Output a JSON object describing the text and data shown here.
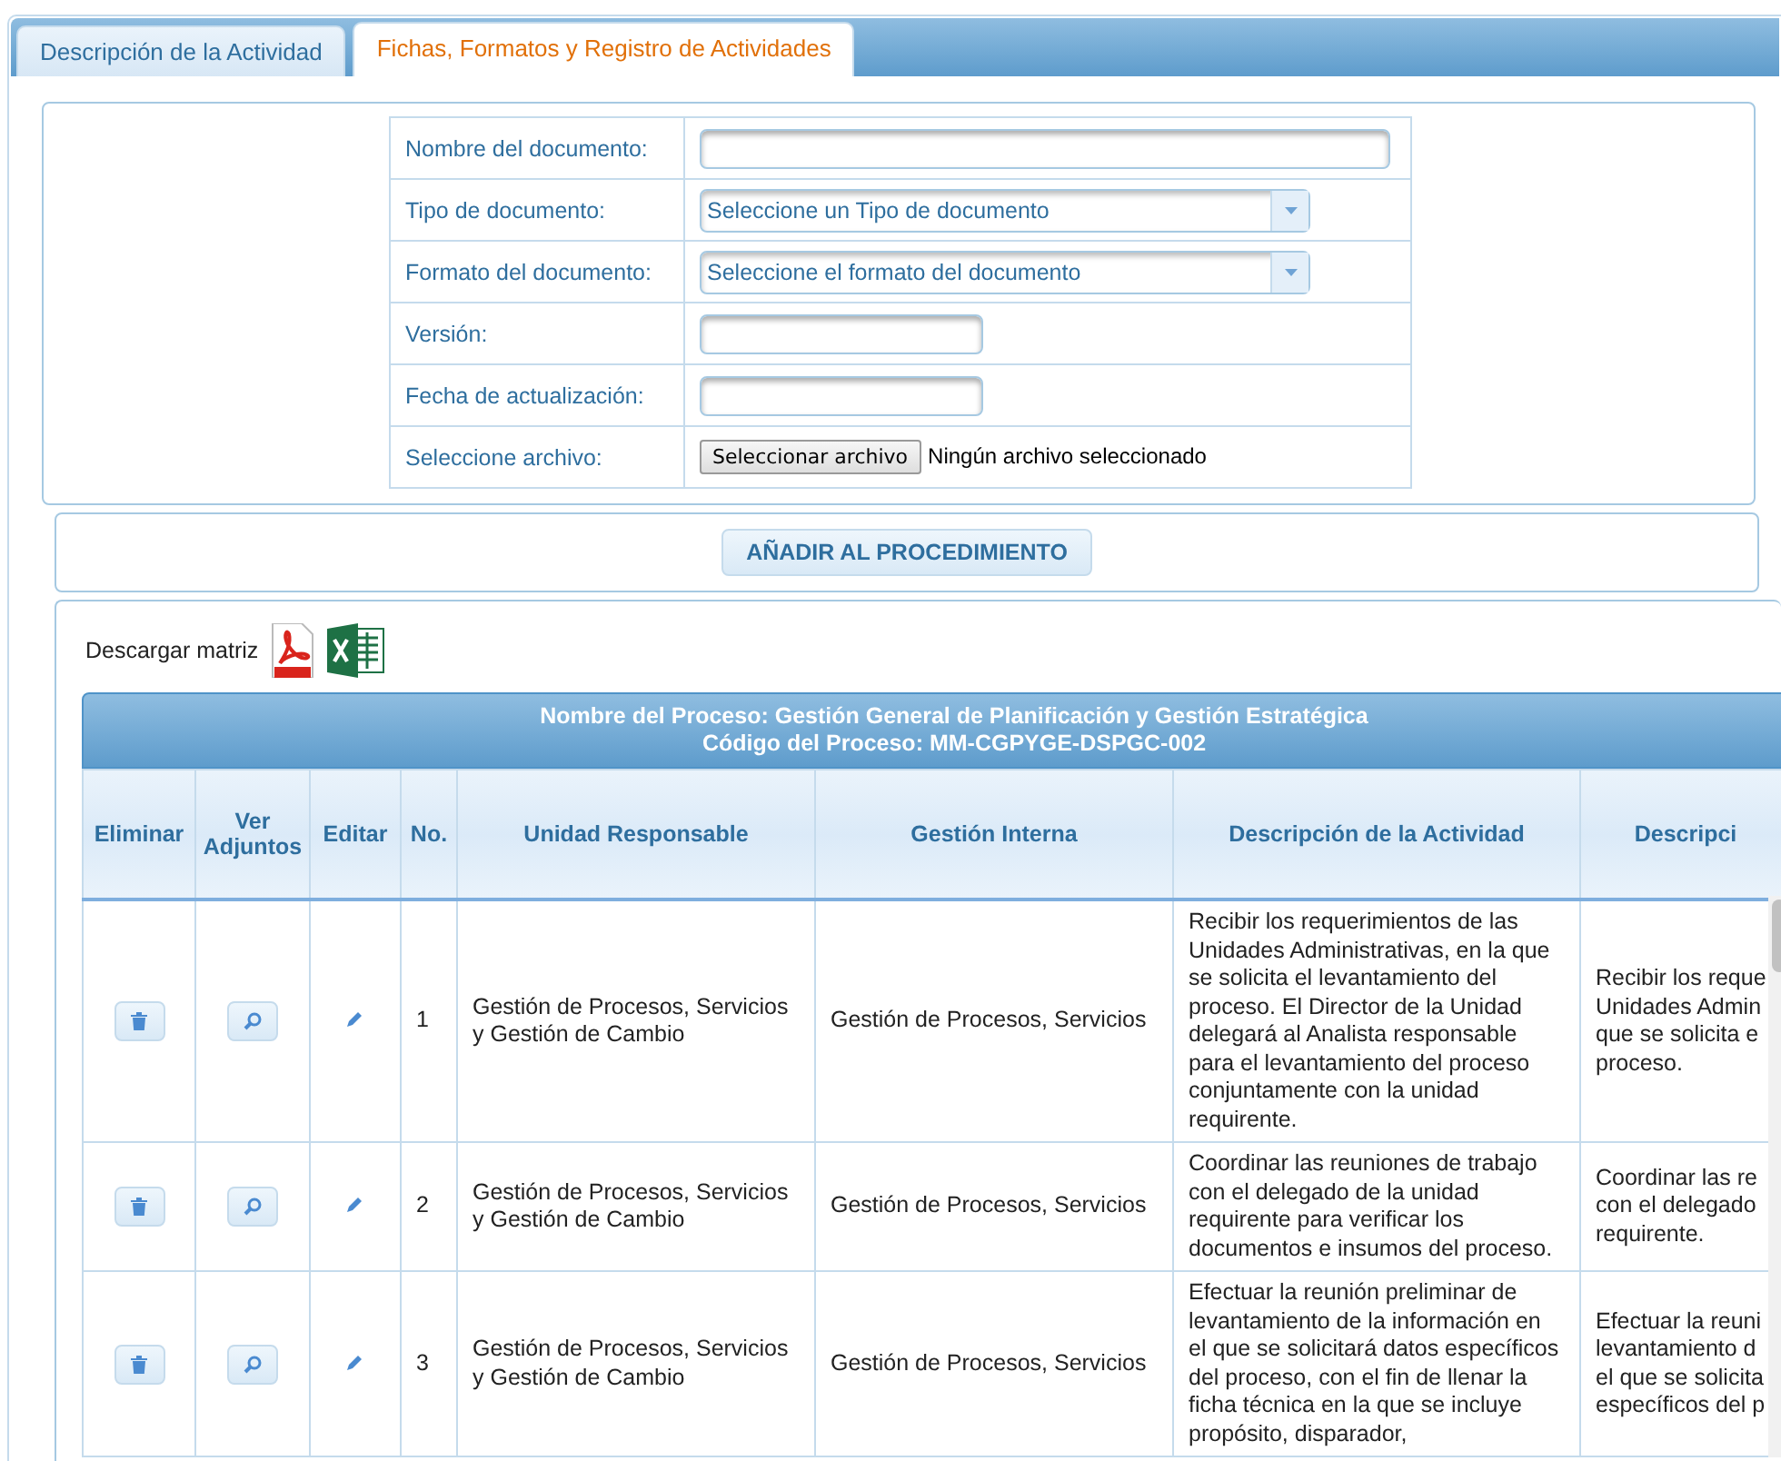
{
  "tabs": [
    {
      "label": "Descripción de la Actividad",
      "selected": false
    },
    {
      "label": "Fichas, Formatos y Registro de Actividades",
      "selected": true
    }
  ],
  "form": {
    "fields": [
      {
        "label": "Nombre del documento:",
        "kind": "long"
      },
      {
        "label": "Tipo de documento:",
        "kind": "select",
        "value": "Seleccione un Tipo de documento"
      },
      {
        "label": "Formato del documento:",
        "kind": "select",
        "value": "Seleccione el formato del documento"
      },
      {
        "label": "Versión:",
        "kind": "short"
      },
      {
        "label": "Fecha de actualización:",
        "kind": "short"
      },
      {
        "label": "Seleccione archivo:",
        "kind": "file",
        "button": "Seleccionar archivo",
        "status": "Ningún archivo seleccionado"
      }
    ]
  },
  "add_button": "AÑADIR AL PROCEDIMIENTO",
  "download": {
    "label": "Descargar matriz"
  },
  "table": {
    "title_lines": [
      "Nombre del Proceso: Gestión General de Planificación y Gestión Estratégica",
      "Código del Proceso: MM-CGPYGE-DSPGC-002"
    ],
    "columns": [
      "Eliminar",
      "Ver Adjuntos",
      "Editar",
      "No.",
      "Unidad Responsable",
      "Gestión Interna",
      "Descripción de la Actividad",
      "Descripci"
    ],
    "rows": [
      {
        "no": "1",
        "unidad": "Gestión de Procesos, Servicios y Gestión de Cambio",
        "gestion": "Gestión de Procesos, Servicios",
        "descripcion": "Recibir los requerimientos de las Unidades Administrativas, en la que se solicita el levantamiento del proceso. El Director de la Unidad delegará al Analista responsable para el levantamiento del proceso conjuntamente con la unidad requirente.",
        "column_8": "Recibir los reque\nUnidades Admin\nque se solicita e\nproceso."
      },
      {
        "no": "2",
        "unidad": "Gestión de Procesos, Servicios y Gestión de Cambio",
        "gestion": "Gestión de Procesos, Servicios",
        "descripcion": "Coordinar las reuniones de trabajo con el delegado de la unidad requirente para verificar los documentos e insumos del proceso.",
        "column_8": "Coordinar las re\ncon el delegado\nrequirente."
      },
      {
        "no": "3",
        "unidad": "Gestión de Procesos, Servicios y Gestión de Cambio",
        "gestion": "Gestión de Procesos, Servicios",
        "descripcion": "Efectuar la reunión preliminar de levantamiento de la información en el que se solicitará datos específicos del proceso, con el fin de llenar la ficha técnica en la que se incluye propósito, disparador,",
        "column_8": "Efectuar la reuni\nlevantamiento d\nel que se solicita\nespecíficos del p"
      }
    ]
  }
}
